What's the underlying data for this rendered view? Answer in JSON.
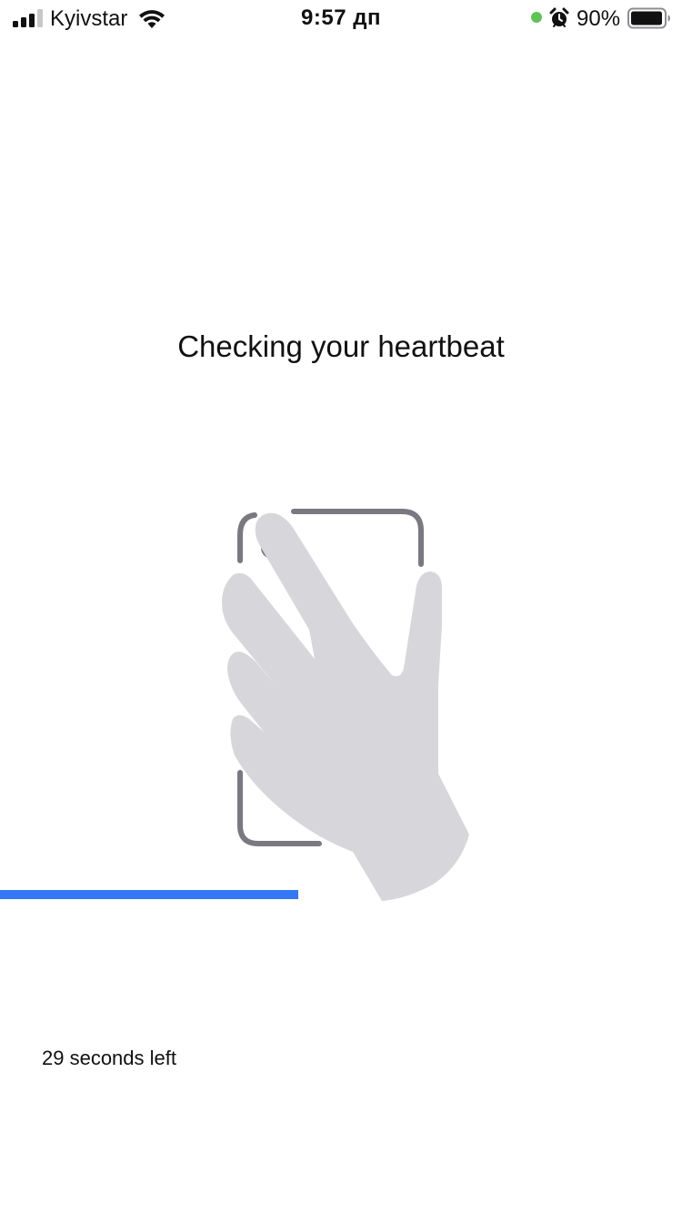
{
  "status_bar": {
    "carrier": "Kyivstar",
    "time": "9:57 дп",
    "battery_percent": "90%",
    "icons": {
      "signal": "cellular-signal-icon",
      "wifi": "wifi-icon",
      "activity_dot": "green-dot-indicator",
      "alarm": "alarm-clock-icon",
      "battery": "battery-icon"
    },
    "colors": {
      "activity_dot": "#5ec456"
    }
  },
  "main": {
    "title": "Checking your heartbeat",
    "illustration": "hand-over-phone-camera-icon",
    "progress": {
      "fraction": 0.437,
      "color": "#3478f6"
    },
    "time_left": "29 seconds left"
  },
  "colors": {
    "phone_outline": "#7a7880",
    "hand_fill": "#d7d7db"
  }
}
